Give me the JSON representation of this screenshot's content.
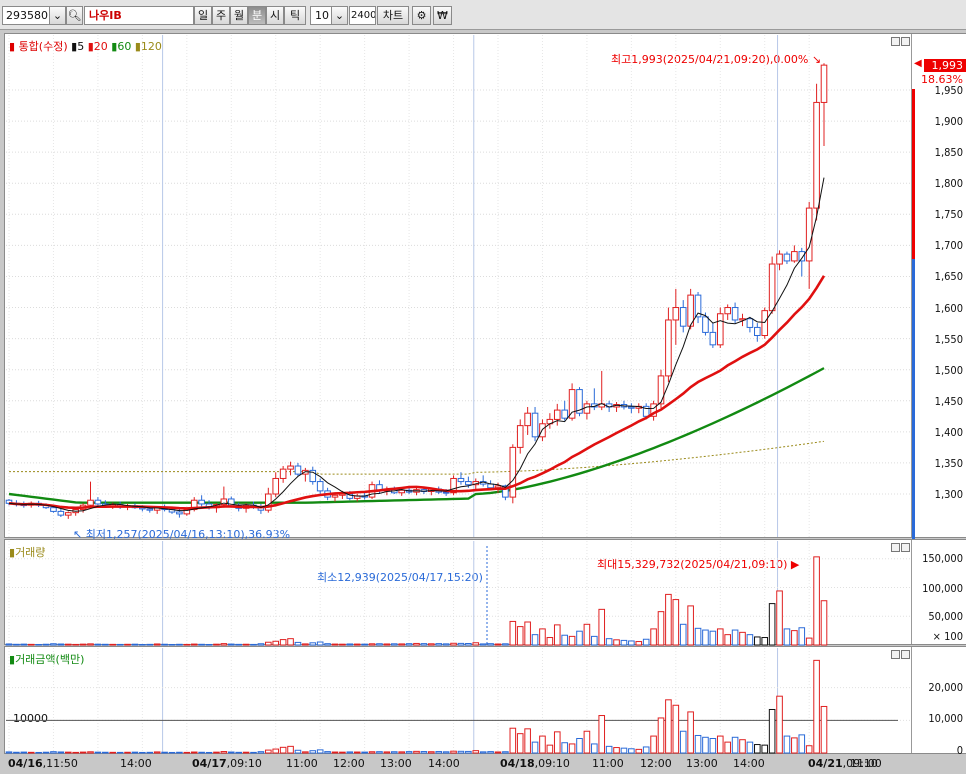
{
  "toolbar": {
    "code": "293580",
    "stock_name": "나우IB",
    "period_buttons": [
      "일",
      "주",
      "월",
      "분",
      "시",
      "틱"
    ],
    "active_period": "분",
    "interval": "10",
    "count": "2400",
    "chart_button": "차트"
  },
  "price_pane": {
    "title": "통합(수정)",
    "ma_labels": [
      "5",
      "20",
      "60",
      "120"
    ],
    "ma_colors": [
      "#111111",
      "#e01010",
      "#128a12",
      "#9a8a1a"
    ],
    "max_note": "최고1,993(2025/04/21,09:20),0.00%",
    "min_note": "최저1,257(2025/04/16,13:10),36.93%",
    "y_ticks": [
      "1,950",
      "1,900",
      "1,850",
      "1,800",
      "1,750",
      "1,700",
      "1,650",
      "1,600",
      "1,550",
      "1,500",
      "1,450",
      "1,400",
      "1,350",
      "1,300"
    ],
    "current_price": "1,993",
    "change_pct": "18.63%"
  },
  "volume_pane": {
    "title": "거래량",
    "max_note": "최대15,329,732(2025/04/21,09:10)",
    "min_note": "최소12,939(2025/04/17,15:20)",
    "y_ticks": [
      "150,000",
      "100,000",
      "50,000",
      "× 100"
    ]
  },
  "amount_pane": {
    "title": "거래금액(백만)",
    "ref_line": "10000",
    "y_ticks": [
      "20,000",
      "10,000",
      "0"
    ]
  },
  "x_axis": [
    "04/16,11:50",
    "14:00",
    "04/17,09:10",
    "11:00",
    "12:00",
    "13:00",
    "14:00",
    "04/18,09:10",
    "11:00",
    "12:00",
    "13:00",
    "14:00",
    "04/21,09:10",
    "11:00"
  ],
  "colors": {
    "up": "#e02020",
    "down": "#2a6ad8",
    "ma5": "#111111",
    "ma20": "#e01010",
    "ma60": "#128a12",
    "ma120": "#9a8a1a"
  },
  "chart_data": {
    "type": "candlestick",
    "candles_ohlc": [
      [
        1290,
        1292,
        1282,
        1285
      ],
      [
        1285,
        1290,
        1280,
        1283
      ],
      [
        1283,
        1288,
        1278,
        1282
      ],
      [
        1282,
        1288,
        1278,
        1285
      ],
      [
        1285,
        1289,
        1279,
        1282
      ],
      [
        1282,
        1285,
        1276,
        1278
      ],
      [
        1278,
        1282,
        1270,
        1272
      ],
      [
        1272,
        1276,
        1263,
        1266
      ],
      [
        1266,
        1272,
        1260,
        1270
      ],
      [
        1270,
        1278,
        1265,
        1275
      ],
      [
        1275,
        1285,
        1270,
        1282
      ],
      [
        1282,
        1320,
        1278,
        1290
      ],
      [
        1290,
        1295,
        1280,
        1284
      ],
      [
        1284,
        1290,
        1278,
        1280
      ],
      [
        1280,
        1286,
        1276,
        1283
      ],
      [
        1283,
        1288,
        1276,
        1279
      ],
      [
        1279,
        1284,
        1274,
        1281
      ],
      [
        1281,
        1285,
        1276,
        1278
      ],
      [
        1278,
        1282,
        1272,
        1276
      ],
      [
        1276,
        1280,
        1270,
        1274
      ],
      [
        1274,
        1280,
        1268,
        1278
      ],
      [
        1278,
        1283,
        1272,
        1275
      ],
      [
        1275,
        1279,
        1268,
        1271
      ],
      [
        1271,
        1276,
        1262,
        1268
      ],
      [
        1268,
        1278,
        1265,
        1275
      ],
      [
        1275,
        1295,
        1272,
        1290
      ],
      [
        1290,
        1298,
        1280,
        1284
      ],
      [
        1284,
        1290,
        1275,
        1278
      ],
      [
        1278,
        1285,
        1270,
        1283
      ],
      [
        1283,
        1312,
        1278,
        1292
      ],
      [
        1292,
        1296,
        1278,
        1281
      ],
      [
        1281,
        1286,
        1272,
        1277
      ],
      [
        1277,
        1285,
        1270,
        1282
      ],
      [
        1282,
        1288,
        1276,
        1279
      ],
      [
        1279,
        1284,
        1268,
        1274
      ],
      [
        1274,
        1310,
        1270,
        1300
      ],
      [
        1300,
        1335,
        1295,
        1325
      ],
      [
        1325,
        1345,
        1318,
        1340
      ],
      [
        1340,
        1352,
        1330,
        1345
      ],
      [
        1345,
        1350,
        1328,
        1332
      ],
      [
        1332,
        1342,
        1320,
        1338
      ],
      [
        1338,
        1344,
        1315,
        1320
      ],
      [
        1320,
        1325,
        1300,
        1305
      ],
      [
        1305,
        1310,
        1290,
        1295
      ],
      [
        1295,
        1302,
        1288,
        1298
      ],
      [
        1298,
        1305,
        1292,
        1300
      ],
      [
        1300,
        1305,
        1290,
        1293
      ],
      [
        1293,
        1300,
        1288,
        1297
      ],
      [
        1297,
        1303,
        1291,
        1295
      ],
      [
        1295,
        1320,
        1292,
        1315
      ],
      [
        1315,
        1322,
        1300,
        1305
      ],
      [
        1305,
        1312,
        1298,
        1308
      ],
      [
        1308,
        1312,
        1300,
        1302
      ],
      [
        1302,
        1309,
        1297,
        1306
      ],
      [
        1306,
        1312,
        1300,
        1303
      ],
      [
        1303,
        1310,
        1298,
        1307
      ],
      [
        1307,
        1311,
        1300,
        1304
      ],
      [
        1304,
        1310,
        1298,
        1308
      ],
      [
        1308,
        1312,
        1300,
        1303
      ],
      [
        1303,
        1308,
        1297,
        1302
      ],
      [
        1302,
        1330,
        1298,
        1325
      ],
      [
        1325,
        1335,
        1315,
        1320
      ],
      [
        1320,
        1328,
        1310,
        1315
      ],
      [
        1315,
        1325,
        1308,
        1320
      ],
      [
        1320,
        1330,
        1312,
        1316
      ],
      [
        1316,
        1322,
        1306,
        1310
      ],
      [
        1310,
        1318,
        1302,
        1313
      ],
      [
        1313,
        1315,
        1290,
        1295
      ],
      [
        1295,
        1380,
        1285,
        1375
      ],
      [
        1375,
        1420,
        1365,
        1410
      ],
      [
        1410,
        1440,
        1395,
        1430
      ],
      [
        1430,
        1440,
        1385,
        1392
      ],
      [
        1392,
        1420,
        1385,
        1413
      ],
      [
        1413,
        1430,
        1405,
        1420
      ],
      [
        1420,
        1445,
        1410,
        1435
      ],
      [
        1435,
        1450,
        1418,
        1422
      ],
      [
        1422,
        1478,
        1418,
        1468
      ],
      [
        1468,
        1472,
        1425,
        1430
      ],
      [
        1430,
        1450,
        1420,
        1445
      ],
      [
        1445,
        1470,
        1435,
        1440
      ],
      [
        1440,
        1498,
        1435,
        1445
      ],
      [
        1445,
        1450,
        1432,
        1440
      ],
      [
        1440,
        1448,
        1432,
        1444
      ],
      [
        1444,
        1450,
        1436,
        1440
      ],
      [
        1440,
        1446,
        1430,
        1438
      ],
      [
        1438,
        1446,
        1430,
        1441
      ],
      [
        1441,
        1446,
        1420,
        1425
      ],
      [
        1425,
        1450,
        1418,
        1445
      ],
      [
        1445,
        1500,
        1438,
        1490
      ],
      [
        1490,
        1600,
        1480,
        1580
      ],
      [
        1580,
        1630,
        1540,
        1600
      ],
      [
        1600,
        1612,
        1560,
        1570
      ],
      [
        1570,
        1630,
        1565,
        1620
      ],
      [
        1620,
        1625,
        1575,
        1585
      ],
      [
        1585,
        1592,
        1555,
        1560
      ],
      [
        1560,
        1575,
        1535,
        1540
      ],
      [
        1540,
        1600,
        1535,
        1590
      ],
      [
        1590,
        1605,
        1580,
        1600
      ],
      [
        1600,
        1608,
        1575,
        1580
      ],
      [
        1580,
        1590,
        1570,
        1582
      ],
      [
        1582,
        1585,
        1560,
        1568
      ],
      [
        1568,
        1575,
        1545,
        1555
      ],
      [
        1555,
        1600,
        1550,
        1595
      ],
      [
        1595,
        1682,
        1590,
        1670
      ],
      [
        1670,
        1692,
        1660,
        1686
      ],
      [
        1686,
        1690,
        1670,
        1675
      ],
      [
        1675,
        1700,
        1672,
        1690
      ],
      [
        1690,
        1696,
        1650,
        1675
      ],
      [
        1675,
        1770,
        1630,
        1760
      ],
      [
        1760,
        1960,
        1740,
        1930
      ],
      [
        1930,
        1993,
        1860,
        1990
      ]
    ],
    "volume_x100": [
      1800,
      1200,
      1500,
      1100,
      900,
      1300,
      2200,
      1700,
      1400,
      1000,
      1500,
      2000,
      1400,
      1200,
      1100,
      1000,
      1200,
      1400,
      900,
      1100,
      1800,
      1300,
      900,
      1200,
      1000,
      1600,
      1200,
      900,
      1400,
      2400,
      1600,
      1100,
      1300,
      1000,
      2200,
      4800,
      6500,
      9400,
      11000,
      4500,
      1900,
      3800,
      5200,
      2300,
      1600,
      1400,
      1800,
      1600,
      1500,
      2100,
      2200,
      1800,
      2100,
      1900,
      2300,
      2700,
      2400,
      2100,
      2400,
      2000,
      3000,
      2800,
      2600,
      3900,
      1900,
      2300,
      1700,
      2100,
      41000,
      32000,
      40000,
      18000,
      28000,
      13000,
      35000,
      17000,
      15000,
      24000,
      36000,
      15000,
      62000,
      11000,
      9000,
      8000,
      7000,
      6000,
      10000,
      28000,
      58000,
      88000,
      79000,
      36000,
      68000,
      29000,
      26000,
      24000,
      28000,
      18000,
      26000,
      22000,
      18000,
      14000,
      13000,
      72000,
      94000,
      28000,
      25000,
      30000,
      12000,
      153297,
      77000
    ],
    "series": [
      {
        "name": "5",
        "note": "short moving average"
      },
      {
        "name": "20",
        "note": "moving average"
      },
      {
        "name": "60",
        "note": "moving average"
      },
      {
        "name": "120",
        "note": "moving average"
      }
    ],
    "ylim": [
      1220,
      2000
    ],
    "volume_ylim": [
      0,
      160000
    ],
    "amount_ylim": [
      0,
      30000
    ]
  }
}
